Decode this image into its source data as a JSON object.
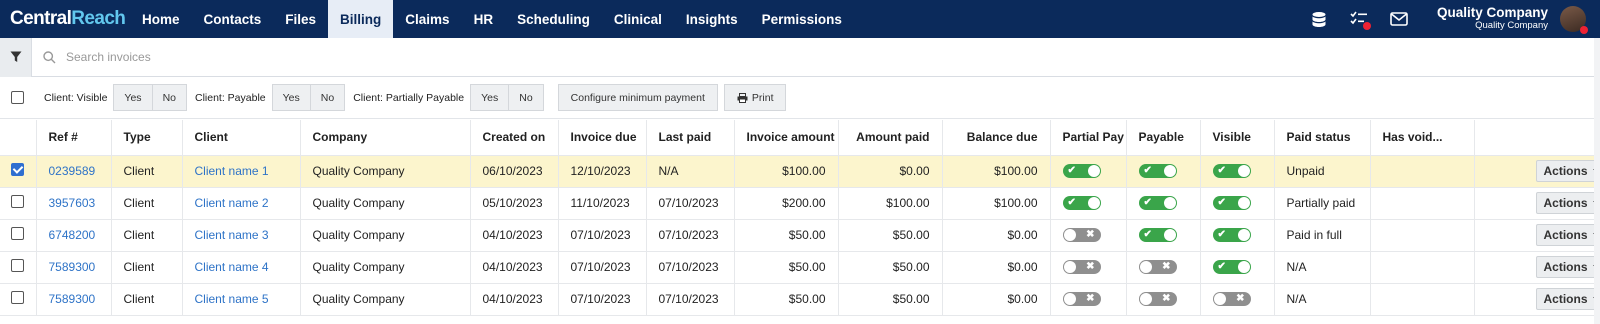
{
  "brand": {
    "part1": "Central",
    "part2": "Reach"
  },
  "nav": {
    "items": [
      {
        "label": "Home"
      },
      {
        "label": "Contacts"
      },
      {
        "label": "Files"
      },
      {
        "label": "Billing"
      },
      {
        "label": "Claims"
      },
      {
        "label": "HR"
      },
      {
        "label": "Scheduling"
      },
      {
        "label": "Clinical"
      },
      {
        "label": "Insights"
      },
      {
        "label": "Permissions"
      }
    ],
    "active": "Billing"
  },
  "user": {
    "name": "Quality Company",
    "org": "Quality Company"
  },
  "icons": {
    "db": "database-icon",
    "tasks": "tasks-icon",
    "mail": "mail-icon",
    "filter": "filter-icon",
    "search": "search-icon",
    "print": "printer-icon"
  },
  "search": {
    "placeholder": "Search invoices",
    "value": ""
  },
  "toolbar": {
    "visible_label": "Client: Visible",
    "payable_label": "Client: Payable",
    "partial_label": "Client: Partially Payable",
    "yes": "Yes",
    "no": "No",
    "configure_label": "Configure minimum payment",
    "print_label": "Print"
  },
  "table": {
    "columns": [
      "Ref #",
      "Type",
      "Client",
      "Company",
      "Created on",
      "Invoice due",
      "Last paid",
      "Invoice amount",
      "Amount paid",
      "Balance due",
      "Partial Pay",
      "Payable",
      "Visible",
      "Paid status",
      "Has void...",
      ""
    ],
    "action_label": "Actions",
    "rows": [
      {
        "selected": true,
        "ref": "0239589",
        "type": "Client",
        "client": "Client name 1",
        "company": "Quality Company",
        "created": "06/10/2023",
        "due": "12/10/2023",
        "last_paid": "N/A",
        "amount": "$100.00",
        "paid": "$0.00",
        "balance": "$100.00",
        "partial": true,
        "payable": true,
        "visible": true,
        "status": "Unpaid",
        "void": ""
      },
      {
        "selected": false,
        "ref": "3957603",
        "type": "Client",
        "client": "Client name 2",
        "company": "Quality Company",
        "created": "05/10/2023",
        "due": "11/10/2023",
        "last_paid": "07/10/2023",
        "amount": "$200.00",
        "paid": "$100.00",
        "balance": "$100.00",
        "partial": true,
        "payable": true,
        "visible": true,
        "status": "Partially paid",
        "void": ""
      },
      {
        "selected": false,
        "ref": "6748200",
        "type": "Client",
        "client": "Client name 3",
        "company": "Quality Company",
        "created": "04/10/2023",
        "due": "07/10/2023",
        "last_paid": "07/10/2023",
        "amount": "$50.00",
        "paid": "$50.00",
        "balance": "$0.00",
        "partial": false,
        "payable": true,
        "visible": true,
        "status": "Paid in full",
        "void": ""
      },
      {
        "selected": false,
        "ref": "7589300",
        "type": "Client",
        "client": "Client name 4",
        "company": "Quality Company",
        "created": "04/10/2023",
        "due": "07/10/2023",
        "last_paid": "07/10/2023",
        "amount": "$50.00",
        "paid": "$50.00",
        "balance": "$0.00",
        "partial": false,
        "payable": false,
        "visible": true,
        "status": "N/A",
        "void": ""
      },
      {
        "selected": false,
        "ref": "7589300",
        "type": "Client",
        "client": "Client name 5",
        "company": "Quality Company",
        "created": "04/10/2023",
        "due": "07/10/2023",
        "last_paid": "07/10/2023",
        "amount": "$50.00",
        "paid": "$50.00",
        "balance": "$0.00",
        "partial": false,
        "payable": false,
        "visible": false,
        "status": "N/A",
        "void": ""
      }
    ]
  },
  "colors": {
    "nav_bg": "#0b2a5b",
    "active_tab_bg": "#e7edf6",
    "brand_accent": "#62c7ee",
    "selected_row": "#fcf5cd",
    "link": "#2e73c7",
    "toggle_on": "#3aa54a",
    "toggle_off": "#8f8f8f",
    "notification": "#ee2233"
  }
}
